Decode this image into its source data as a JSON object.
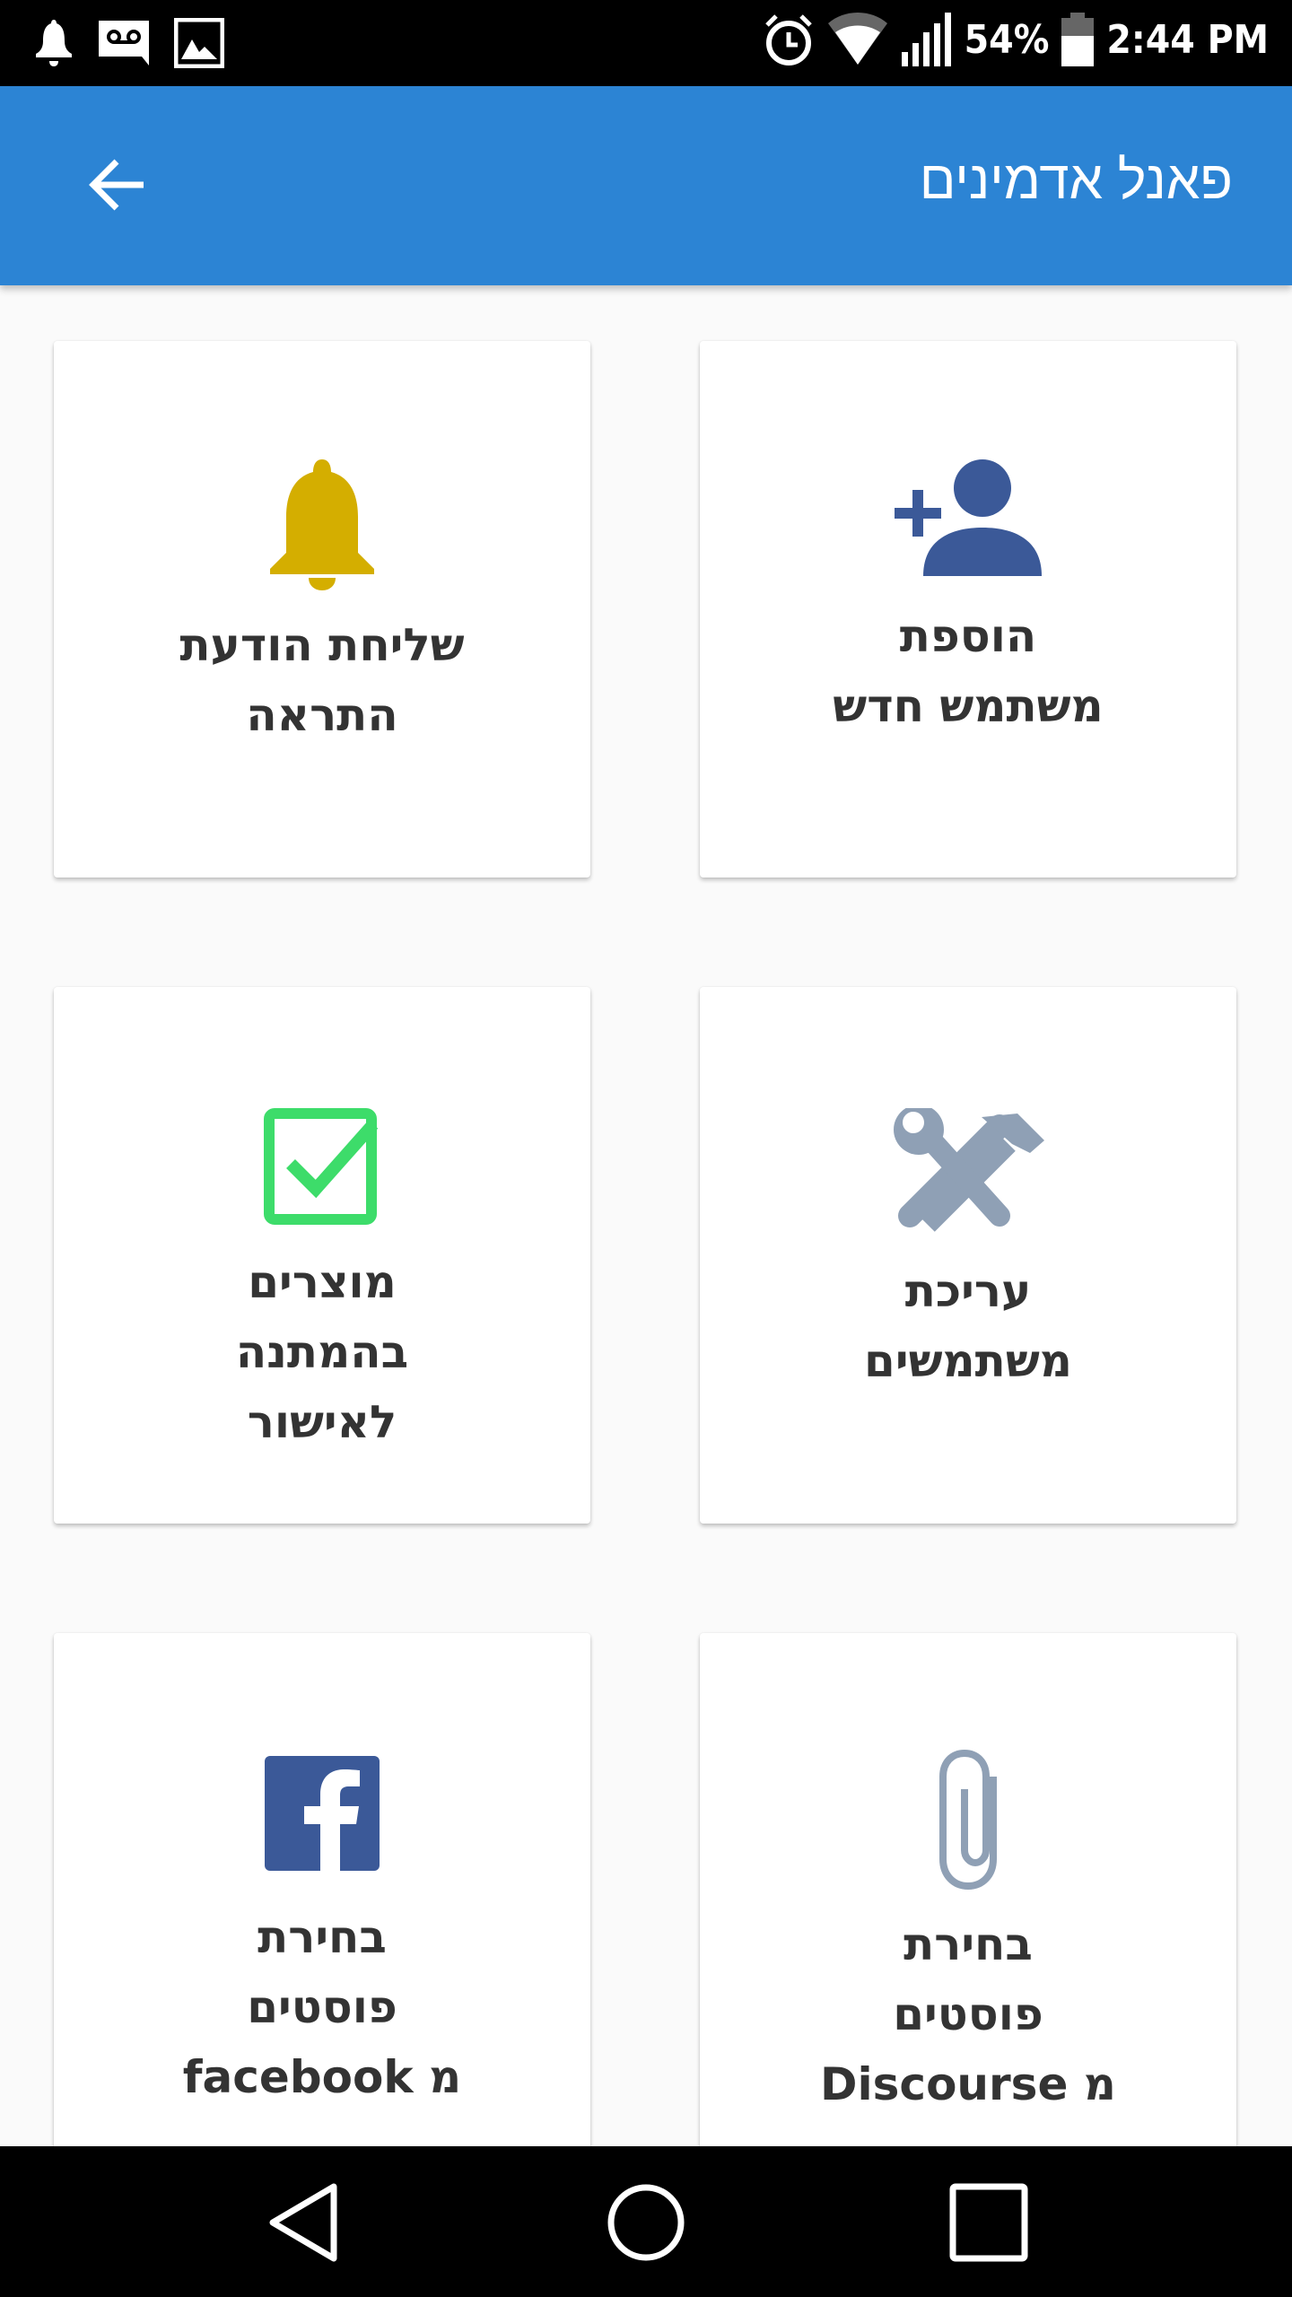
{
  "status_bar": {
    "left_icons": [
      "notification-bell-icon",
      "voicemail-icon",
      "image-icon"
    ],
    "right_icons": [
      "alarm-icon",
      "wifi-icon",
      "signal-icon",
      "battery-icon"
    ],
    "battery": "54%",
    "time": "2:44 PM"
  },
  "app_bar": {
    "title": "פאנל אדמינים",
    "back_icon": "arrow-left-icon"
  },
  "cards": [
    {
      "icon": "bell-icon",
      "color": "#d4ae00",
      "lines": [
        "שליחת הודעת",
        "התראה"
      ]
    },
    {
      "icon": "add-user-icon",
      "color": "#3b5998",
      "lines": [
        "הוספת",
        "משתמש חדש"
      ]
    },
    {
      "icon": "checkbox-icon",
      "color": "#3ddc6a",
      "lines": [
        "מוצרים",
        "בהמתנה",
        "לאישור"
      ]
    },
    {
      "icon": "tools-icon",
      "color": "#8fa0b5",
      "lines": [
        "עריכת",
        "משתמשים"
      ]
    },
    {
      "icon": "facebook-icon",
      "color": "#3b5998",
      "lines": [
        "בחירת",
        "פוסטים",
        "מ facebook"
      ]
    },
    {
      "icon": "paperclip-icon",
      "color": "#8fa0b5",
      "lines": [
        "בחירת",
        "פוסטים",
        "מ Discourse"
      ]
    }
  ],
  "nav_bar": {
    "icons": [
      "back-triangle-icon",
      "home-circle-icon",
      "recents-square-icon"
    ]
  }
}
